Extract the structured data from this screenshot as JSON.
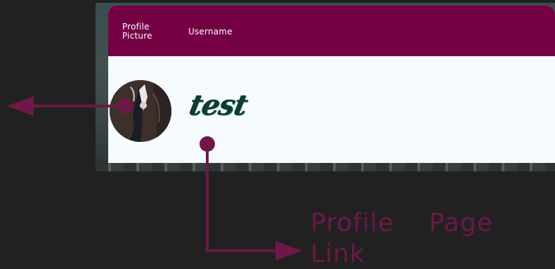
{
  "table": {
    "headers": {
      "profile_picture": "Profile\nPicture",
      "username": "Username"
    },
    "rows": [
      {
        "username": "test"
      }
    ]
  },
  "annotations": {
    "line1": "Profile    Page",
    "line2": "Link"
  },
  "colors": {
    "header": "#740044",
    "body": "#f5fbfe",
    "annotation": "#6d1848",
    "username_text": "#0f3b32",
    "page_bg": "#212121"
  },
  "icons": {
    "arrow_left": "arrow-left-icon",
    "arrow_right": "arrow-right-icon"
  }
}
